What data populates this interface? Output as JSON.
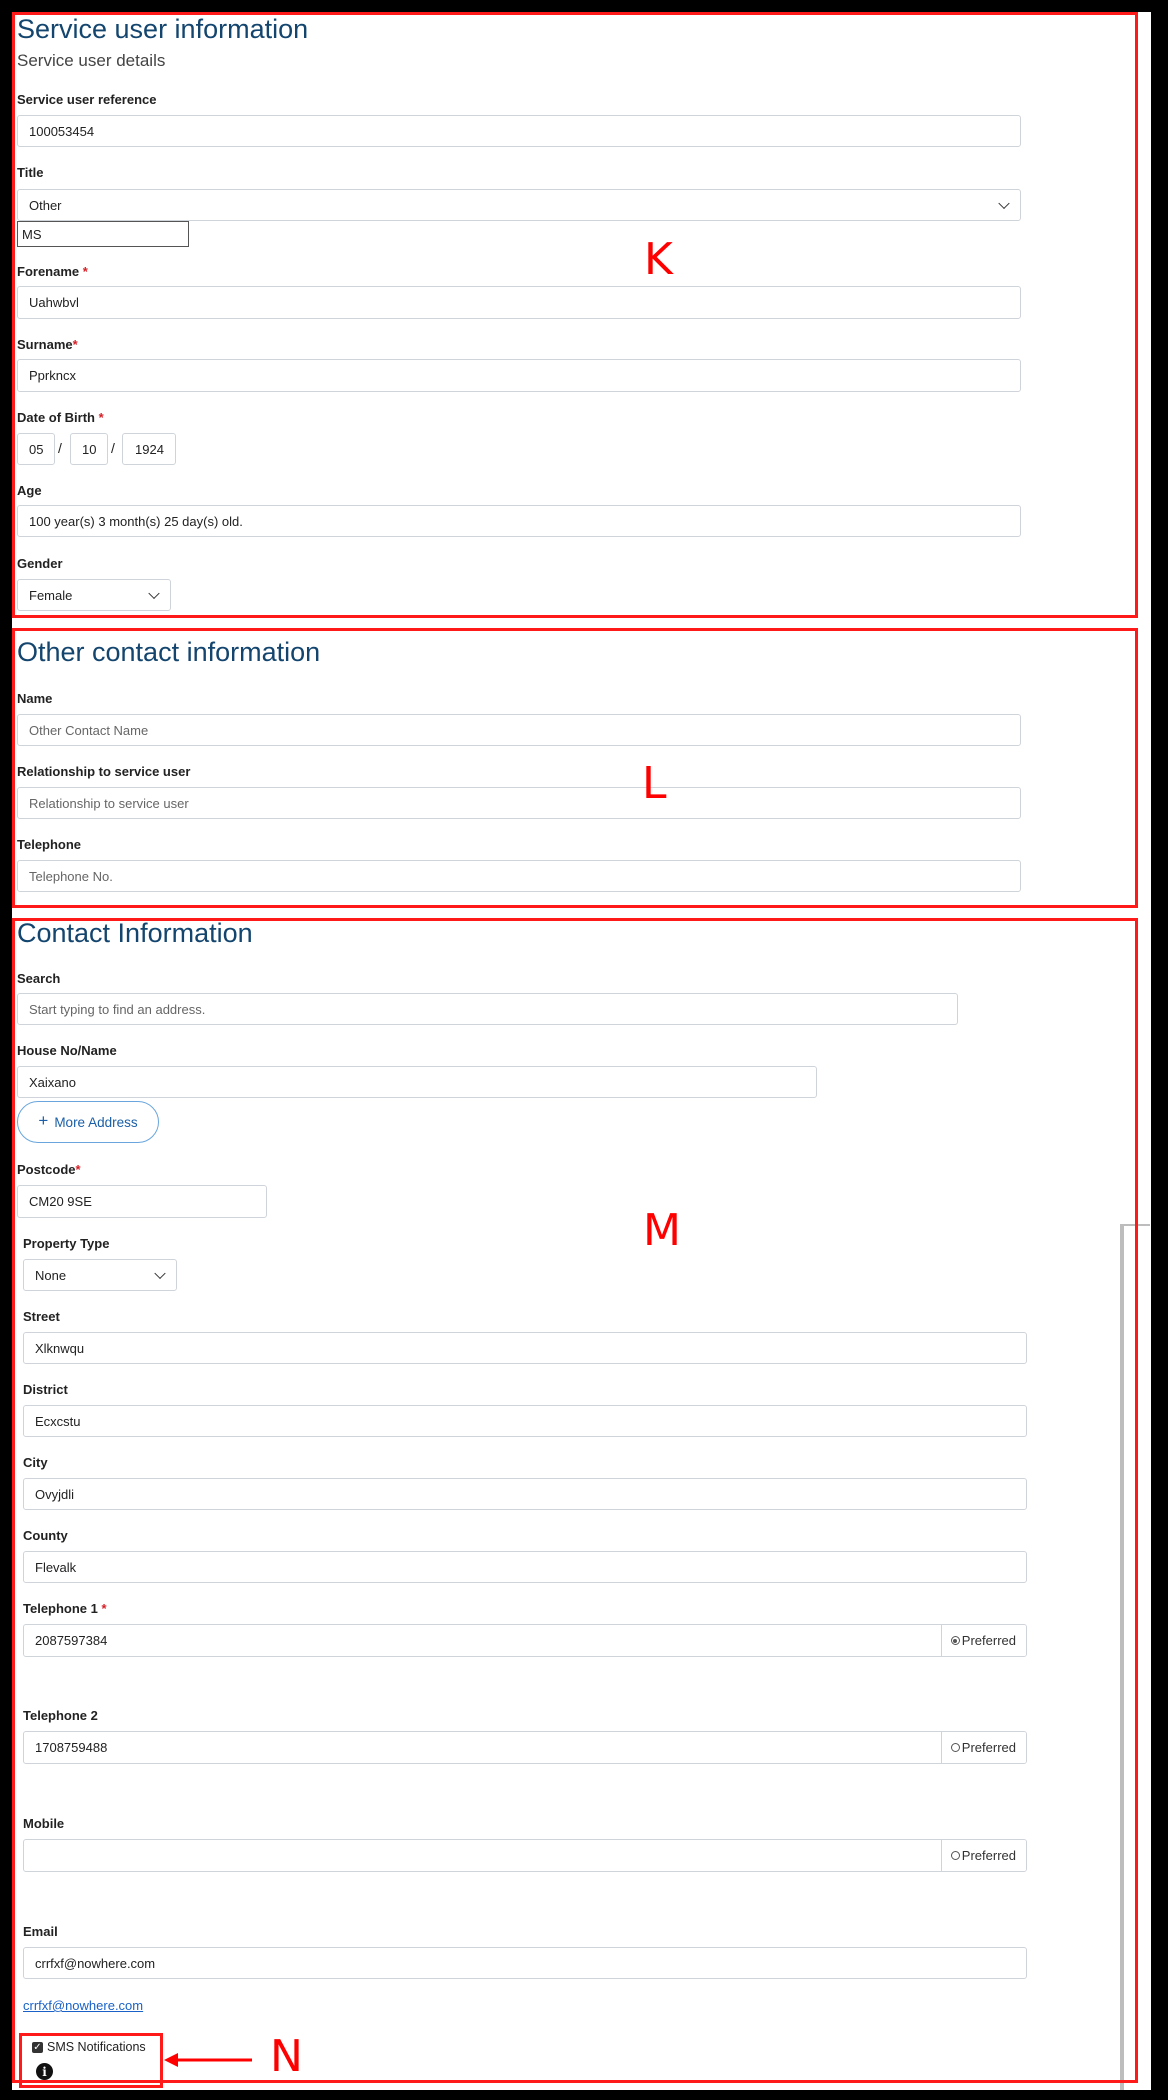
{
  "service_user": {
    "heading": "Service user information",
    "subheading": "Service user details",
    "reference_label": "Service user reference",
    "reference_value": "100053454",
    "title_label": "Title",
    "title_value": "Other",
    "title_other_value": "MS",
    "forename_label": "Forename",
    "forename_value": "Uahwbvl",
    "surname_label": "Surname",
    "surname_value": "Pprkncx",
    "dob_label": "Date of Birth",
    "dob_day": "05",
    "dob_month": "10",
    "dob_year": "1924",
    "dob_sep": "/",
    "age_label": "Age",
    "age_value": "100 year(s) 3 month(s) 25 day(s) old.",
    "gender_label": "Gender",
    "gender_value": "Female",
    "required_mark": "*"
  },
  "other_contact": {
    "heading": "Other contact information",
    "name_label": "Name",
    "name_placeholder": "Other Contact Name",
    "relationship_label": "Relationship to service user",
    "relationship_placeholder": "Relationship to service user",
    "telephone_label": "Telephone",
    "telephone_placeholder": "Telephone No."
  },
  "contact_info": {
    "heading": "Contact Information",
    "search_label": "Search",
    "search_placeholder": "Start typing to find an address.",
    "house_label": "House No/Name",
    "house_value": "Xaixano",
    "more_address_icon": "+",
    "more_address_label": "More Address",
    "postcode_label": "Postcode",
    "postcode_value": "CM20 9SE",
    "property_type_label": "Property Type",
    "property_type_value": "None",
    "street_label": "Street",
    "street_value": "Xlknwqu",
    "district_label": "District",
    "district_value": "Ecxcstu",
    "city_label": "City",
    "city_value": "Ovyjdli",
    "county_label": "County",
    "county_value": "Flevalk",
    "tel1_label": "Telephone 1",
    "tel1_value": "2087597384",
    "tel2_label": "Telephone 2",
    "tel2_value": "1708759488",
    "mobile_label": "Mobile",
    "mobile_value": "",
    "preferred_label": "Preferred",
    "email_label": "Email",
    "email_value": "crrfxf@nowhere.com",
    "email_link": "crrfxf@nowhere.com",
    "sms_label": "SMS Notifications",
    "info_icon": "i",
    "sms_check": "✓"
  },
  "annotations": {
    "k": "K",
    "l": "L",
    "m": "M",
    "n": "N",
    "color": "#ff0000"
  },
  "colors": {
    "heading": "#13456e",
    "required": "#d31f26",
    "link": "#1a62c7"
  }
}
